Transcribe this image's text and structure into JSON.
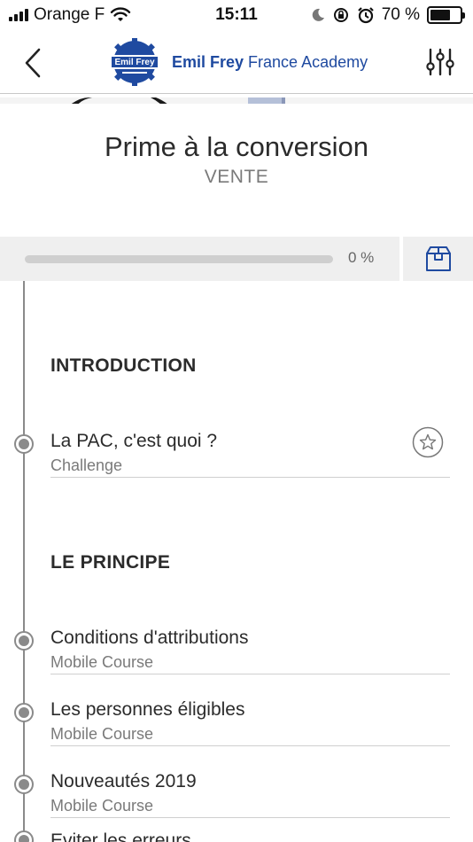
{
  "status_bar": {
    "carrier": "Orange F",
    "time": "15:11",
    "battery": "70 %",
    "battery_level": 0.7
  },
  "header": {
    "brand_bold": "Emil Frey",
    "brand_rest": " France Academy",
    "logo_text": "Emil Frey",
    "brand_color": "#1f4aa0"
  },
  "course": {
    "title": "Prime à la conversion",
    "category": "VENTE"
  },
  "progress": {
    "value": 0,
    "label": "0 %"
  },
  "sections": [
    {
      "title": "INTRODUCTION"
    },
    {
      "title": "LE PRINCIPE"
    }
  ],
  "items": [
    {
      "title": "La PAC, c'est quoi ?",
      "type": "Challenge"
    },
    {
      "title": "Conditions d'attributions",
      "type": "Mobile Course"
    },
    {
      "title": "Les personnes éligibles",
      "type": "Mobile Course"
    },
    {
      "title": "Nouveautés 2019",
      "type": "Mobile Course"
    },
    {
      "title": "Eviter les erreurs",
      "type": ""
    }
  ],
  "icons": {
    "back": "chevron-left-icon",
    "filter": "sliders-icon",
    "box": "box-icon",
    "star": "star-icon"
  }
}
